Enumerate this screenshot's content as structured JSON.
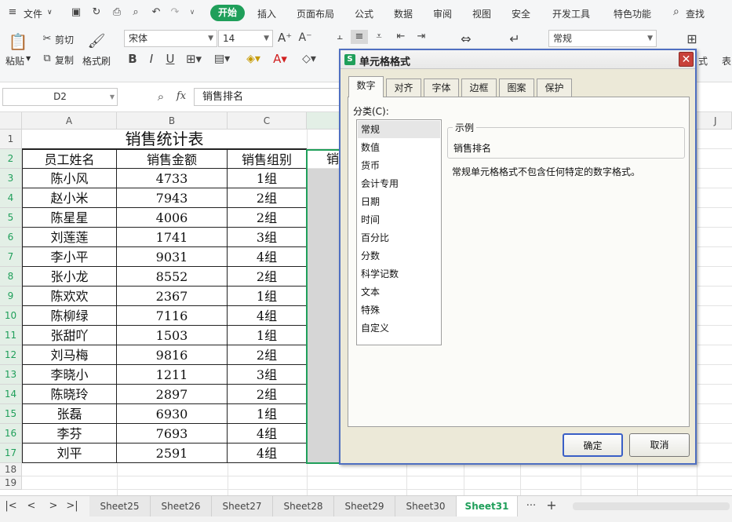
{
  "menu": {
    "file": "文件",
    "tabs": [
      "插入",
      "页面布局",
      "公式",
      "数据",
      "审阅",
      "视图",
      "安全",
      "开发工具",
      "特色功能"
    ],
    "active_tab": "开始",
    "search": "查找"
  },
  "ribbon": {
    "paste": "粘贴",
    "cut": "剪切",
    "copy": "复制",
    "format_painter": "格式刷",
    "font_name": "宋体",
    "font_size": "14",
    "number_format": "常规",
    "right_label": "式",
    "right_label2": "表"
  },
  "formula_bar": {
    "name_box": "D2",
    "fx": "fx",
    "value": "销售排名"
  },
  "sheet": {
    "columns": [
      "A",
      "B",
      "C",
      "J"
    ],
    "title": "销售统计表",
    "headers": [
      "员工姓名",
      "销售金额",
      "销售组别",
      "销"
    ],
    "rows": [
      {
        "name": "陈小风",
        "amount": "4733",
        "group": "1组"
      },
      {
        "name": "赵小米",
        "amount": "7943",
        "group": "2组"
      },
      {
        "name": "陈星星",
        "amount": "4006",
        "group": "2组"
      },
      {
        "name": "刘莲莲",
        "amount": "1741",
        "group": "3组"
      },
      {
        "name": "李小平",
        "amount": "9031",
        "group": "4组"
      },
      {
        "name": "张小龙",
        "amount": "8552",
        "group": "2组"
      },
      {
        "name": "陈欢欢",
        "amount": "2367",
        "group": "1组"
      },
      {
        "name": "陈柳绿",
        "amount": "7116",
        "group": "4组"
      },
      {
        "name": "张甜吖",
        "amount": "1503",
        "group": "1组"
      },
      {
        "name": "刘马梅",
        "amount": "9816",
        "group": "2组"
      },
      {
        "name": "李晓小",
        "amount": "1211",
        "group": "3组"
      },
      {
        "name": "陈晓玲",
        "amount": "2897",
        "group": "2组"
      },
      {
        "name": "张磊",
        "amount": "6930",
        "group": "1组"
      },
      {
        "name": "李芬",
        "amount": "7693",
        "group": "4组"
      },
      {
        "name": "刘平",
        "amount": "2591",
        "group": "4组"
      }
    ],
    "row_numbers": [
      "1",
      "2",
      "3",
      "4",
      "5",
      "6",
      "7",
      "8",
      "9",
      "10",
      "11",
      "12",
      "13",
      "14",
      "15",
      "16",
      "17",
      "18",
      "19"
    ]
  },
  "sheet_tabs": {
    "tabs": [
      "Sheet25",
      "Sheet26",
      "Sheet27",
      "Sheet28",
      "Sheet29",
      "Sheet30",
      "Sheet31"
    ],
    "active": "Sheet31",
    "more": "···",
    "add": "+"
  },
  "dialog": {
    "title": "单元格格式",
    "logo": "S",
    "tabs": [
      "数字",
      "对齐",
      "字体",
      "边框",
      "图案",
      "保护"
    ],
    "category_label": "分类(C):",
    "categories": [
      "常规",
      "数值",
      "货币",
      "会计专用",
      "日期",
      "时间",
      "百分比",
      "分数",
      "科学记数",
      "文本",
      "特殊",
      "自定义"
    ],
    "selected_category": "常规",
    "sample_label": "示例",
    "sample_value": "销售排名",
    "description": "常规单元格格式不包含任何特定的数字格式。",
    "ok": "确定",
    "cancel": "取消"
  },
  "colors": {
    "accent": "#1f9f5a",
    "dialog_border": "#4f6fc1",
    "dialog_bg": "#ece9d8"
  }
}
